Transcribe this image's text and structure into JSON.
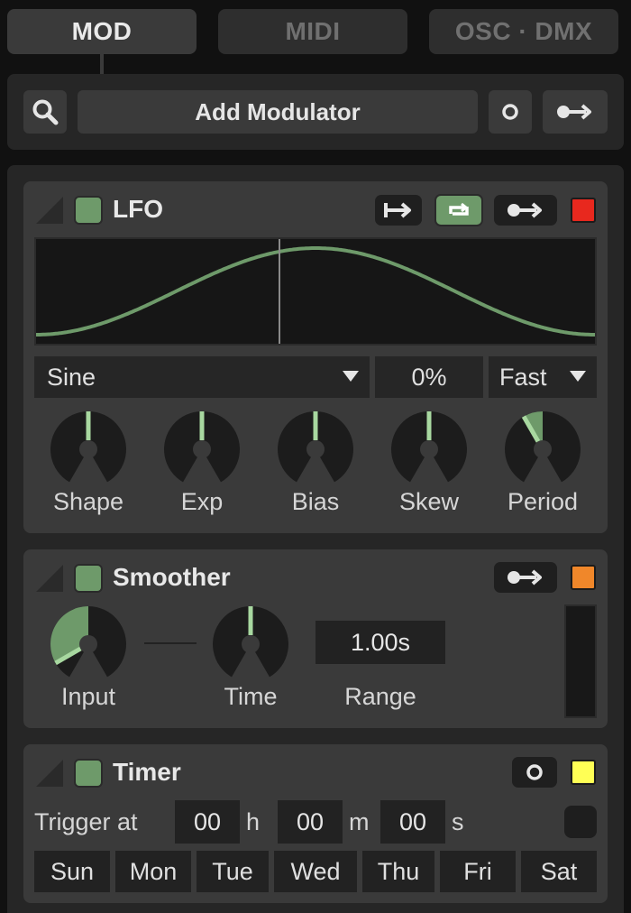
{
  "tabs": [
    {
      "label": "MOD",
      "active": true
    },
    {
      "label": "MIDI",
      "active": false
    },
    {
      "label": "OSC · DMX",
      "active": false
    }
  ],
  "toolbar": {
    "search_icon": "search-icon",
    "add_label": "Add Modulator",
    "circle_icon": "record-circle-icon",
    "connect_icon": "connect-arrow-icon"
  },
  "lfo": {
    "title": "LFO",
    "enabled": true,
    "color": "#e8281e",
    "waveform": "Sine",
    "phase": "0%",
    "rate": "Fast",
    "knobs": [
      {
        "label": "Shape",
        "value": 0.5
      },
      {
        "label": "Exp",
        "value": 0.5
      },
      {
        "label": "Bias",
        "value": 0.5
      },
      {
        "label": "Skew",
        "value": 0.5
      },
      {
        "label": "Period",
        "value": 0.4
      }
    ]
  },
  "smoother": {
    "title": "Smoother",
    "enabled": true,
    "color": "#f0872a",
    "input_label": "Input",
    "input_value": 0.1,
    "time_label": "Time",
    "time_value": 0.5,
    "range_label": "Range",
    "range_value": "1.00s"
  },
  "timer": {
    "title": "Timer",
    "enabled": true,
    "color": "#ffff55",
    "trigger_label": "Trigger at",
    "hours": "00",
    "hours_unit": "h",
    "minutes": "00",
    "minutes_unit": "m",
    "seconds": "00",
    "seconds_unit": "s",
    "days": [
      "Sun",
      "Mon",
      "Tue",
      "Wed",
      "Thu",
      "Fri",
      "Sat"
    ]
  }
}
